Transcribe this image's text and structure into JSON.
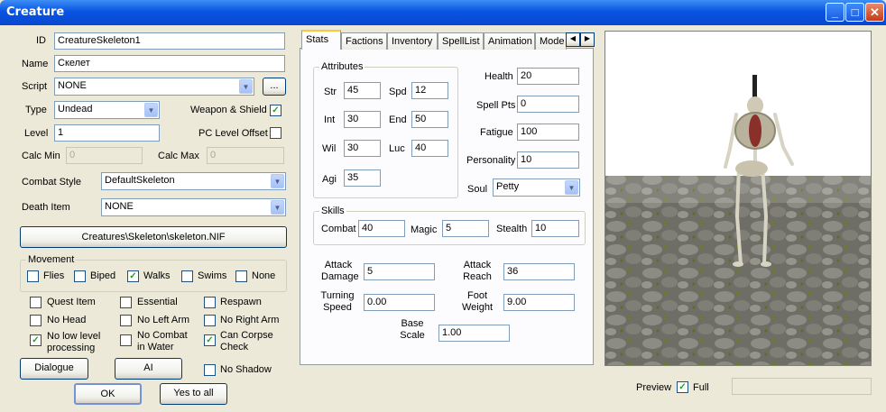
{
  "window": {
    "title": "Creature"
  },
  "left": {
    "id_label": "ID",
    "id_value": "CreatureSkeleton1",
    "name_label": "Name",
    "name_value": "Скелет",
    "script_label": "Script",
    "script_value": "NONE",
    "script_btn": "...",
    "type_label": "Type",
    "type_value": "Undead",
    "weapon_shield_label": "Weapon & Shield",
    "level_label": "Level",
    "level_value": "1",
    "pc_level_offset_label": "PC Level Offset",
    "calc_min_label": "Calc Min",
    "calc_min_value": "0",
    "calc_max_label": "Calc Max",
    "calc_max_value": "0",
    "combat_style_label": "Combat Style",
    "combat_style_value": "DefaultSkeleton",
    "death_item_label": "Death Item",
    "death_item_value": "NONE",
    "model_button": "Creatures\\Skeleton\\skeleton.NIF",
    "movement_label": "Movement",
    "movement": {
      "flies": "Flies",
      "biped": "Biped",
      "walks": "Walks",
      "swims": "Swims",
      "none": "None"
    },
    "flags": {
      "quest_item": "Quest Item",
      "essential": "Essential",
      "respawn": "Respawn",
      "no_head": "No Head",
      "no_left_arm": "No Left Arm",
      "no_right_arm": "No Right Arm",
      "no_low_level_1": "No low level",
      "no_low_level_2": "processing",
      "no_combat_1": "No Combat",
      "no_combat_2": "in Water",
      "can_corpse_1": "Can Corpse",
      "can_corpse_2": "Check",
      "no_shadow": "No Shadow"
    },
    "dialogue_button": "Dialogue",
    "ai_button": "AI",
    "ok_button": "OK",
    "yes_to_all_button": "Yes to all"
  },
  "tabs": [
    "Stats",
    "Factions",
    "Inventory",
    "SpellList",
    "Animation",
    "Mode"
  ],
  "stats": {
    "attributes_label": "Attributes",
    "str_label": "Str",
    "str": "45",
    "spd_label": "Spd",
    "spd": "12",
    "int_label": "Int",
    "int": "30",
    "end_label": "End",
    "end": "50",
    "wil_label": "Wil",
    "wil": "30",
    "luc_label": "Luc",
    "luc": "40",
    "agi_label": "Agi",
    "agi": "35",
    "health_label": "Health",
    "health": "20",
    "spell_pts_label": "Spell Pts",
    "spell_pts": "0",
    "fatigue_label": "Fatigue",
    "fatigue": "100",
    "personality_label": "Personality",
    "personality": "10",
    "soul_label": "Soul",
    "soul": "Petty",
    "skills_label": "Skills",
    "combat_label": "Combat",
    "combat": "40",
    "magic_label": "Magic",
    "magic": "5",
    "stealth_label": "Stealth",
    "stealth": "10",
    "attack_damage_1": "Attack",
    "attack_damage_2": "Damage",
    "attack_damage": "5",
    "attack_reach_1": "Attack",
    "attack_reach_2": "Reach",
    "attack_reach": "36",
    "turning_speed_1": "Turning",
    "turning_speed_2": "Speed",
    "turning_speed": "0.00",
    "foot_weight_1": "Foot",
    "foot_weight_2": "Weight",
    "foot_weight": "9.00",
    "base_scale_1": "Base",
    "base_scale_2": "Scale",
    "base_scale": "1.00"
  },
  "preview": {
    "label": "Preview",
    "full_label": "Full"
  }
}
